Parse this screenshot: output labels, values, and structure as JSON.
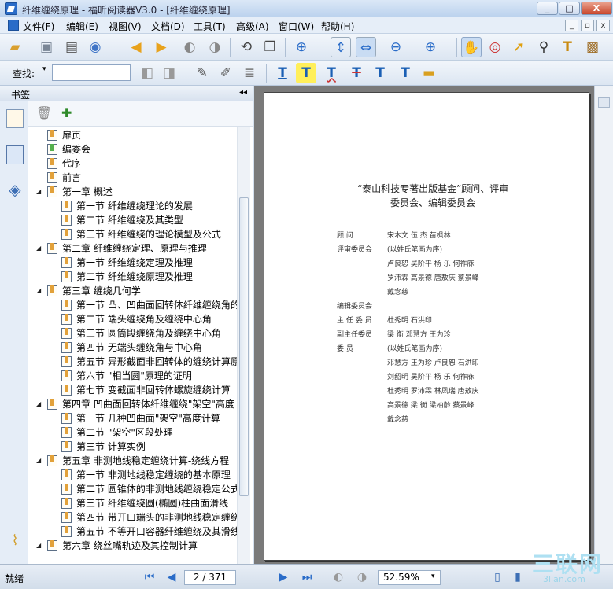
{
  "window": {
    "title": "纤维缠绕原理 - 福昕阅读器V3.0 - [纤维缠绕原理]",
    "min": "_",
    "max": "□",
    "close": "X"
  },
  "menu": [
    "文件(F)",
    "编辑(E)",
    "视图(V)",
    "文档(D)",
    "工具(T)",
    "高级(A)",
    "窗口(W)",
    "帮助(H)"
  ],
  "find": {
    "label": "查找:",
    "value": ""
  },
  "sidebar": {
    "title": "书签",
    "pin": "◂◂"
  },
  "bookmarks": [
    {
      "label": "扉页",
      "level": 0
    },
    {
      "label": "编委会",
      "level": 0,
      "green": true
    },
    {
      "label": "代序",
      "level": 0
    },
    {
      "label": "前言",
      "level": 0
    },
    {
      "label": "第一章 概述",
      "level": 0,
      "expander": true
    },
    {
      "label": "第一节 纤维缠绕理论的发展",
      "level": 1
    },
    {
      "label": "第二节 纤维缠绕及其类型",
      "level": 1
    },
    {
      "label": "第三节 纤维缠绕的理论模型及公式",
      "level": 1
    },
    {
      "label": "第二章 纤维缠绕定理、原理与推理",
      "level": 0,
      "expander": true
    },
    {
      "label": "第一节 纤维缠绕定理及推理",
      "level": 1
    },
    {
      "label": "第二节 纤维缠绕原理及推理",
      "level": 1
    },
    {
      "label": "第三章 缠绕几何学",
      "level": 0,
      "expander": true
    },
    {
      "label": "第一节 凸、凹曲面回转体纤维缠绕角的",
      "level": 1
    },
    {
      "label": "第二节 端头缠绕角及缠绕中心角",
      "level": 1
    },
    {
      "label": "第三节 圆筒段缠绕角及缠绕中心角",
      "level": 1
    },
    {
      "label": "第四节 无端头缠绕角与中心角",
      "level": 1
    },
    {
      "label": "第五节 异形截面非回转体的缠绕计算原",
      "level": 1
    },
    {
      "label": "第六节 \"相当圆\"原理的证明",
      "level": 1
    },
    {
      "label": "第七节 变截面非回转体螺旋缠绕计算",
      "level": 1
    },
    {
      "label": "第四章 凹曲面回转体纤维缠绕\"架空\"高度",
      "level": 0,
      "expander": true
    },
    {
      "label": "第一节 几种凹曲面\"架空\"高度计算",
      "level": 1
    },
    {
      "label": "第二节 \"架空\"区段处理",
      "level": 1
    },
    {
      "label": "第三节 计算实例",
      "level": 1
    },
    {
      "label": "第五章 非测地线稳定缠绕计算-绕线方程",
      "level": 0,
      "expander": true
    },
    {
      "label": "第一节 非测地线稳定缠绕的基本原理",
      "level": 1
    },
    {
      "label": "第二节 圆锥体的非测地线缠绕稳定公式",
      "level": 1
    },
    {
      "label": "第三节 纤维缠绕圆(椭圆)柱曲面滑线",
      "level": 1
    },
    {
      "label": "第四节 带开口端头的非测地线稳定缠绕",
      "level": 1
    },
    {
      "label": "第五节 不等开口容器纤维缠绕及其滑线",
      "level": 1
    },
    {
      "label": "第六章 绕丝嘴轨迹及其控制计算",
      "level": 0,
      "expander": true
    }
  ],
  "document": {
    "title1": "“泰山科技专著出版基金”顾问、评审",
    "title2": "委员会、编辑委员会",
    "rows": [
      {
        "a": "顾 问",
        "b": "宋木文 伍 杰 苗枫林"
      },
      {
        "a": "评审委员会",
        "b": "(以姓氏笔画为序)"
      },
      {
        "a": "",
        "b": "卢良恕 吴阶平 杨 乐 何祚庥"
      },
      {
        "a": "",
        "b": "罗沛霖 高景德 唐敖庆 蔡景峰"
      },
      {
        "a": "",
        "b": "戴念慈"
      },
      {
        "a": "编辑委员会",
        "b": ""
      },
      {
        "a": "主 任 委 员",
        "b": "杜秀明 石洪印"
      },
      {
        "a": "副主任委员",
        "b": "梁 衡 邓慧方 王为珍"
      },
      {
        "a": "委 员",
        "b": "(以姓氏笔画为序)"
      },
      {
        "a": "",
        "b": "邓慧方 王为珍 卢良恕 石洪印"
      },
      {
        "a": "",
        "b": "刘韶明 吴阶平 杨 乐 何祚庥"
      },
      {
        "a": "",
        "b": "杜秀明 罗沛霖 林凤瑞 唐敖庆"
      },
      {
        "a": "",
        "b": "高景德 梁 衡 梁柏龄 蔡景峰"
      },
      {
        "a": "",
        "b": "戴念慈"
      }
    ]
  },
  "status": {
    "text": "就绪",
    "page": "2 / 371",
    "zoom": "52.59%"
  },
  "watermark": {
    "big": "三联网",
    "small": "3lian.com"
  }
}
